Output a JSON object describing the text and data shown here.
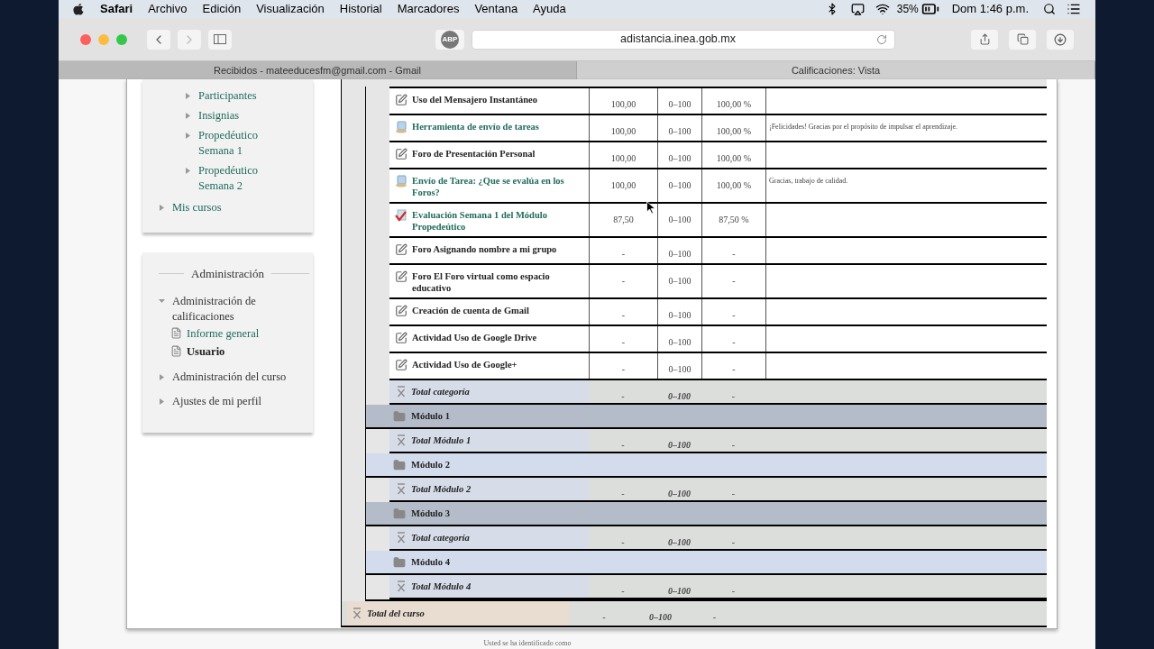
{
  "menubar": {
    "app": "Safari",
    "items": [
      "Archivo",
      "Edición",
      "Visualización",
      "Historial",
      "Marcadores",
      "Ventana",
      "Ayuda"
    ],
    "battery": "35%",
    "clock": "Dom 1:46 p.m."
  },
  "browser": {
    "adblock": "ABP",
    "url": "adistancia.inea.gob.mx",
    "tabs": [
      {
        "title": "Recibidos - mateeducesfm@gmail.com - Gmail",
        "selected": false
      },
      {
        "title": "Calificaciones: Vista",
        "selected": true
      }
    ]
  },
  "navigation": {
    "sub_items": [
      {
        "label": "Participantes"
      },
      {
        "label": "Insignias"
      },
      {
        "label": "Propedéutico Semana 1"
      },
      {
        "label": "Propedéutico Semana 2"
      }
    ],
    "items": [
      {
        "label": "Mis cursos"
      }
    ]
  },
  "administration": {
    "title": "Administración",
    "items": [
      {
        "label": "Administración de calificaciones",
        "expanded": true,
        "children": [
          {
            "label": "Informe general",
            "selected": false
          },
          {
            "label": "Usuario",
            "selected": true
          }
        ]
      },
      {
        "label": "Administración del curso",
        "expanded": false
      },
      {
        "label": "Ajustes de mi perfil",
        "expanded": false
      }
    ]
  },
  "grades": {
    "sections": [
      {
        "rows": [
          {
            "kind": "forum",
            "name": "Uso del Mensajero Instantáneo",
            "grade": "100,00",
            "range": "0–100",
            "percentage": "100,00 %"
          },
          {
            "kind": "assignment",
            "name": "Herramienta de envío de tareas",
            "grade": "100,00",
            "range": "0–100",
            "percentage": "100,00 %",
            "feedback": "¡Felicidades! Gracias por el propósito de impulsar el aprendizaje."
          },
          {
            "kind": "forum",
            "name": "Foro de Presentación Personal",
            "grade": "100,00",
            "range": "0–100",
            "percentage": "100,00 %"
          },
          {
            "kind": "assignment",
            "name": "Envío de Tarea: ¿Que se evalúa en los Foros?",
            "grade": "100,00",
            "range": "0–100",
            "percentage": "100,00 %",
            "feedback": "Gracias, trabajo de calidad."
          },
          {
            "kind": "quiz",
            "name": "Evaluación Semana 1 del Módulo Propedeútico",
            "grade": "87,50",
            "range": "0–100",
            "percentage": "87,50 %"
          },
          {
            "kind": "forum",
            "name": "Foro Asignando nombre a mi grupo",
            "grade": "-",
            "range": "0–100",
            "percentage": "-"
          },
          {
            "kind": "forum",
            "name": "Foro El Foro virtual como espacio educativo",
            "grade": "-",
            "range": "0–100",
            "percentage": "-"
          },
          {
            "kind": "forum",
            "name": "Creación de cuenta de Gmail",
            "grade": "-",
            "range": "0–100",
            "percentage": "-"
          },
          {
            "kind": "forum",
            "name": "Actividad Uso de Google Drive",
            "grade": "-",
            "range": "0–100",
            "percentage": "-"
          },
          {
            "kind": "forum",
            "name": "Actividad Uso de Google+",
            "grade": "-",
            "range": "0–100",
            "percentage": "-"
          },
          {
            "kind": "total",
            "name": "Total categoría",
            "grade": "-",
            "range": "0–100",
            "percentage": "-"
          }
        ]
      },
      {
        "title": "Módulo 1",
        "rows": [
          {
            "kind": "total",
            "name": "Total Módulo 1",
            "grade": "-",
            "range": "0–100",
            "percentage": "-"
          }
        ]
      },
      {
        "title": "Módulo 2",
        "rows": [
          {
            "kind": "total",
            "name": "Total Módulo 2",
            "grade": "-",
            "range": "0–100",
            "percentage": "-"
          }
        ]
      },
      {
        "title": "Módulo 3",
        "rows": [
          {
            "kind": "total",
            "name": "Total categoría",
            "grade": "-",
            "range": "0–100",
            "percentage": "-"
          }
        ]
      },
      {
        "title": "Módulo 4",
        "rows": [
          {
            "kind": "total",
            "name": "Total Módulo 4",
            "grade": "-",
            "range": "0–100",
            "percentage": "-"
          }
        ]
      }
    ],
    "course_total": {
      "name": "Total del curso",
      "grade": "-",
      "range": "0–100",
      "percentage": "-"
    }
  },
  "footer": {
    "text": "Usted se ha identificado como"
  }
}
